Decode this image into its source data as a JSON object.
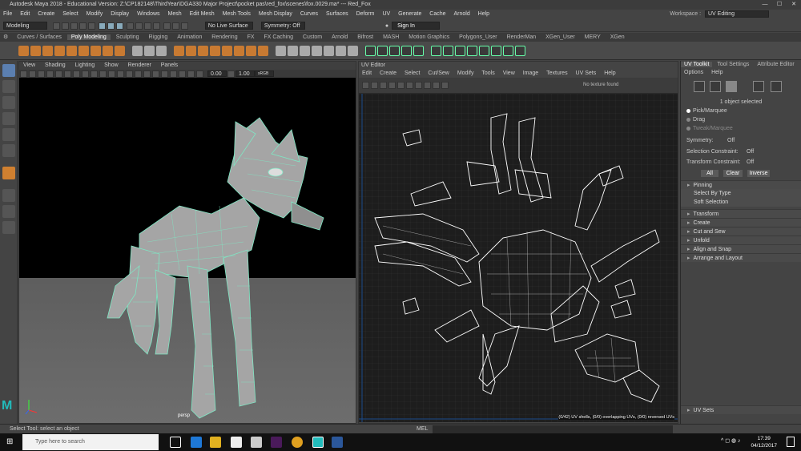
{
  "titlebar": {
    "title": "Autodesk Maya 2018 - Educational Version: Z:\\CP182148\\ThirdYear\\DGA330 Major Project\\pocket pas\\red_fox\\scenes\\fox.0029.ma*  ---  Red_Fox",
    "minimize": "—",
    "maximize": "☐",
    "close": "✕"
  },
  "menubar": {
    "items": [
      "File",
      "Edit",
      "Create",
      "Select",
      "Modify",
      "Display",
      "Windows",
      "Mesh",
      "Edit Mesh",
      "Mesh Tools",
      "Mesh Display",
      "Curves",
      "Surfaces",
      "Deform",
      "UV",
      "Generate",
      "Cache",
      "Arnold",
      "Help"
    ],
    "workspace_label": "Workspace :",
    "workspace_value": "UV Editing"
  },
  "statusline": {
    "mode": "Modeling",
    "live_surface": "No Live Surface",
    "symmetry": "Symmetry: Off",
    "sign_in": "Sign In"
  },
  "shelf_tabs": [
    "Curves / Surfaces",
    "Poly Modeling",
    "Sculpting",
    "Rigging",
    "Animation",
    "Rendering",
    "FX",
    "FX Caching",
    "Custom",
    "Arnold",
    "Bifrost",
    "MASH",
    "Motion Graphics",
    "Polygons_User",
    "RenderMan",
    "XGen_User",
    "MERY",
    "XGen"
  ],
  "viewport": {
    "menu": [
      "View",
      "Shading",
      "Lighting",
      "Show",
      "Renderer",
      "Panels"
    ],
    "field1": "0.00",
    "field2": "1.00",
    "color_space": "sRGB g",
    "camera_label": "persp"
  },
  "uv_editor": {
    "title": "UV Editor",
    "menu": [
      "Edit",
      "Create",
      "Select",
      "Cut/Sew",
      "Modify",
      "Tools",
      "View",
      "Image",
      "Textures",
      "UV Sets",
      "Help"
    ],
    "no_texture": "No texture found",
    "status": "(0/42) UV shells, (0/0) overlapping UVs, (0/0) reversed UVs"
  },
  "panel": {
    "tabs": [
      "UV Toolkit",
      "Tool Settings",
      "Attribute Editor"
    ],
    "menu": [
      "Options",
      "Help"
    ],
    "selection_info": "1 object selected",
    "radio_items": [
      "Pick/Marquee",
      "Drag",
      "Tweak/Marquee"
    ],
    "symmetry_label": "Symmetry:",
    "symmetry_value": "Off",
    "selection_constraint_label": "Selection Constraint:",
    "selection_constraint_value": "Off",
    "transform_constraint_label": "Transform Constraint:",
    "transform_constraint_value": "Off",
    "buttons": [
      "All",
      "Clear",
      "Inverse"
    ],
    "sections_open": [
      "Pinning",
      "Select By Type",
      "Soft Selection"
    ],
    "sections": [
      "Transform",
      "Create",
      "Cut and Sew",
      "Unfold",
      "Align and Snap",
      "Arrange and Layout"
    ],
    "uv_sets": "UV Sets"
  },
  "commandline": {
    "help_text": "Select Tool: select an object",
    "mel_label": "MEL"
  },
  "taskbar": {
    "search_placeholder": "Type here to search",
    "time": "17:39",
    "date": "04/12/2017"
  }
}
